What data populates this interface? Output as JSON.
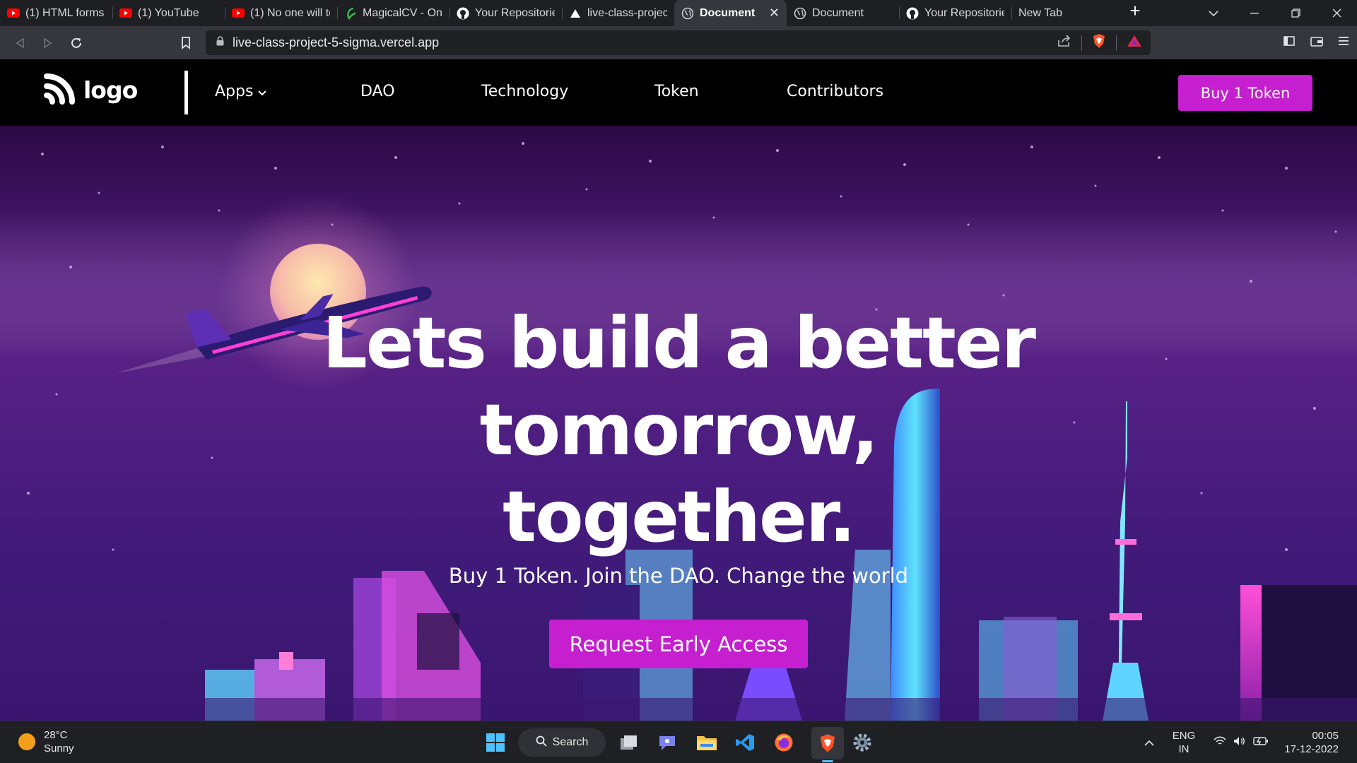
{
  "browser": {
    "tabs": [
      {
        "label": "(1) HTML forms a",
        "icon": "youtube-icon"
      },
      {
        "label": "(1) YouTube",
        "icon": "youtube-icon"
      },
      {
        "label": "(1) No one will te",
        "icon": "youtube-icon"
      },
      {
        "label": "MagicalCV - Onli",
        "icon": "magicalcv-icon"
      },
      {
        "label": "Your Repositorie",
        "icon": "github-icon"
      },
      {
        "label": "live-class-project",
        "icon": "vercel-icon"
      },
      {
        "label": "Document",
        "icon": "globe-icon",
        "active": true
      },
      {
        "label": "Document",
        "icon": "globe-icon"
      },
      {
        "label": "Your Repositorie",
        "icon": "github-icon"
      },
      {
        "label": "New Tab",
        "icon": ""
      }
    ],
    "url": "live-class-project-5-sigma.vercel.app"
  },
  "site": {
    "logo_text": "logo",
    "nav": {
      "apps": "Apps",
      "dao": "DAO",
      "technology": "Technology",
      "token": "Token",
      "contributors": "Contributors"
    },
    "buy_button": "Buy 1 Token",
    "hero": {
      "title_line1": "Lets build a better",
      "title_line2": "tomorrow,",
      "title_line3": "together.",
      "subtitle": "Buy 1 Token. Join the DAO. Change the world",
      "cta": "Request Early Access"
    },
    "colors": {
      "accent": "#c51fd0",
      "header_bg": "#000000",
      "hero_bg": "#4c1d80"
    }
  },
  "taskbar": {
    "weather_temp": "28°C",
    "weather_desc": "Sunny",
    "search_label": "Search",
    "lang_line1": "ENG",
    "lang_line2": "IN",
    "time": "00:05",
    "date": "17-12-2022"
  }
}
